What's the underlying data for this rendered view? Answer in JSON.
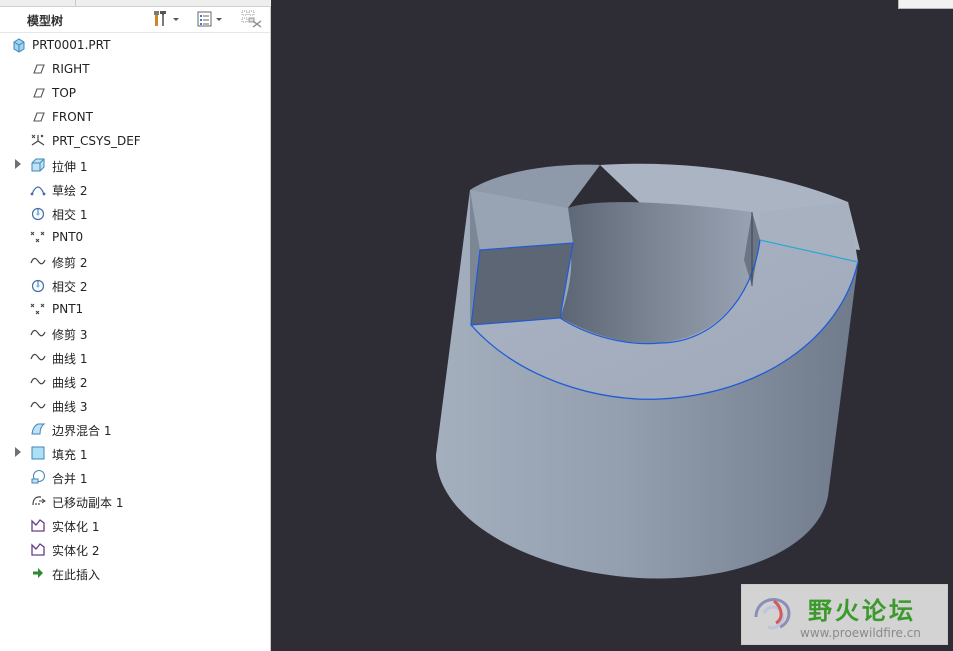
{
  "panel": {
    "title": "模型树"
  },
  "tree": {
    "root": {
      "label": "PRT0001.PRT",
      "icon": "part-icon"
    },
    "items": [
      {
        "label": "RIGHT",
        "icon": "datum-plane-icon",
        "expandable": false
      },
      {
        "label": "TOP",
        "icon": "datum-plane-icon",
        "expandable": false
      },
      {
        "label": "FRONT",
        "icon": "datum-plane-icon",
        "expandable": false
      },
      {
        "label": "PRT_CSYS_DEF",
        "icon": "csys-icon",
        "expandable": false
      },
      {
        "label": "拉伸 1",
        "icon": "extrude-icon",
        "expandable": true
      },
      {
        "label": "草绘 2",
        "icon": "sketch-icon",
        "expandable": false
      },
      {
        "label": "相交 1",
        "icon": "intersect-icon",
        "expandable": false
      },
      {
        "label": "PNT0",
        "icon": "datum-point-icon",
        "expandable": false
      },
      {
        "label": "修剪 2",
        "icon": "curve-icon",
        "expandable": false
      },
      {
        "label": "相交 2",
        "icon": "intersect-icon",
        "expandable": false
      },
      {
        "label": "PNT1",
        "icon": "datum-point-icon",
        "expandable": false
      },
      {
        "label": "修剪 3",
        "icon": "curve-icon",
        "expandable": false
      },
      {
        "label": "曲线 1",
        "icon": "curve-icon",
        "expandable": false
      },
      {
        "label": "曲线 2",
        "icon": "curve-icon",
        "expandable": false
      },
      {
        "label": "曲线 3",
        "icon": "curve-icon",
        "expandable": false
      },
      {
        "label": "边界混合 1",
        "icon": "boundary-blend-icon",
        "expandable": false
      },
      {
        "label": "填充 1",
        "icon": "fill-icon",
        "expandable": true
      },
      {
        "label": "合并 1",
        "icon": "merge-icon",
        "expandable": false
      },
      {
        "label": "已移动副本 1",
        "icon": "moved-copy-icon",
        "expandable": false
      },
      {
        "label": "实体化 1",
        "icon": "solidify-icon",
        "expandable": false
      },
      {
        "label": "实体化 2",
        "icon": "solidify-icon",
        "expandable": false
      },
      {
        "label": "在此插入",
        "icon": "insert-here-arrow-icon",
        "expandable": false
      }
    ]
  },
  "colors": {
    "viewport_bg": "#2e2d36",
    "model_surface": "#9aa6b6",
    "edge_highlight": "#1e5bd6",
    "watermark_green": "#3b9a2b"
  },
  "watermark": {
    "title": "野火论坛",
    "url": "www.proewildfire.cn"
  }
}
